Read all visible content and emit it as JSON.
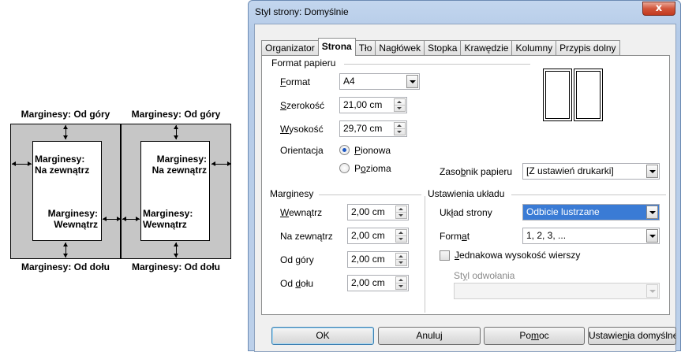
{
  "diagram": {
    "top_left": "Marginesy: Od góry",
    "top_right": "Marginesy: Od góry",
    "bottom_left": "Marginesy: Od dołu",
    "bottom_right": "Marginesy: Od dołu",
    "page1_outer_1": "Marginesy:",
    "page1_outer_2": "Na zewnątrz",
    "page1_inner_1": "Marginesy:",
    "page1_inner_2": "Wewnątrz",
    "page2_outer_1": "Marginesy:",
    "page2_outer_2": "Na zewnątrz",
    "page2_inner_1": "Marginesy:",
    "page2_inner_2": "Wewnątrz"
  },
  "dialog": {
    "title": "Styl strony: Domyślnie",
    "close_glyph": "x",
    "tabs": [
      "Organizator",
      "Strona",
      "Tło",
      "Nagłówek",
      "Stopka",
      "Krawędzie",
      "Kolumny",
      "Przypis dolny"
    ],
    "paper": {
      "section": "Format papieru",
      "format_label": "Format",
      "format_value": "A4",
      "width_label": "Szerokość",
      "width_value": "21,00 cm",
      "height_label": "Wysokość",
      "height_value": "29,70 cm",
      "orientation_label": "Orientacja",
      "portrait": "Pionowa",
      "landscape": "Pozioma",
      "tray_label": "Zasobnik papieru",
      "tray_value": "[Z ustawień drukarki]"
    },
    "margins": {
      "section": "Marginesy",
      "inner_label": "Wewnątrz",
      "inner_value": "2,00 cm",
      "outer_label": "Na zewnątrz",
      "outer_value": "2,00 cm",
      "top_label": "Od góry",
      "top_value": "2,00 cm",
      "bottom_label": "Od dołu",
      "bottom_value": "2,00 cm"
    },
    "layout": {
      "section": "Ustawienia układu",
      "page_layout_label": "Układ strony",
      "page_layout_value": "Odbicie lustrzane",
      "format_label": "Format",
      "format_value": "1, 2, 3, ...",
      "register_label": "Jednakowa wysokość wierszy",
      "reference_style_label": "Styl odwołania",
      "reference_style_value": ""
    },
    "buttons": {
      "ok": "OK",
      "cancel": "Anuluj",
      "help": "Pomoc",
      "defaults": "Ustawienia domyślne"
    }
  }
}
